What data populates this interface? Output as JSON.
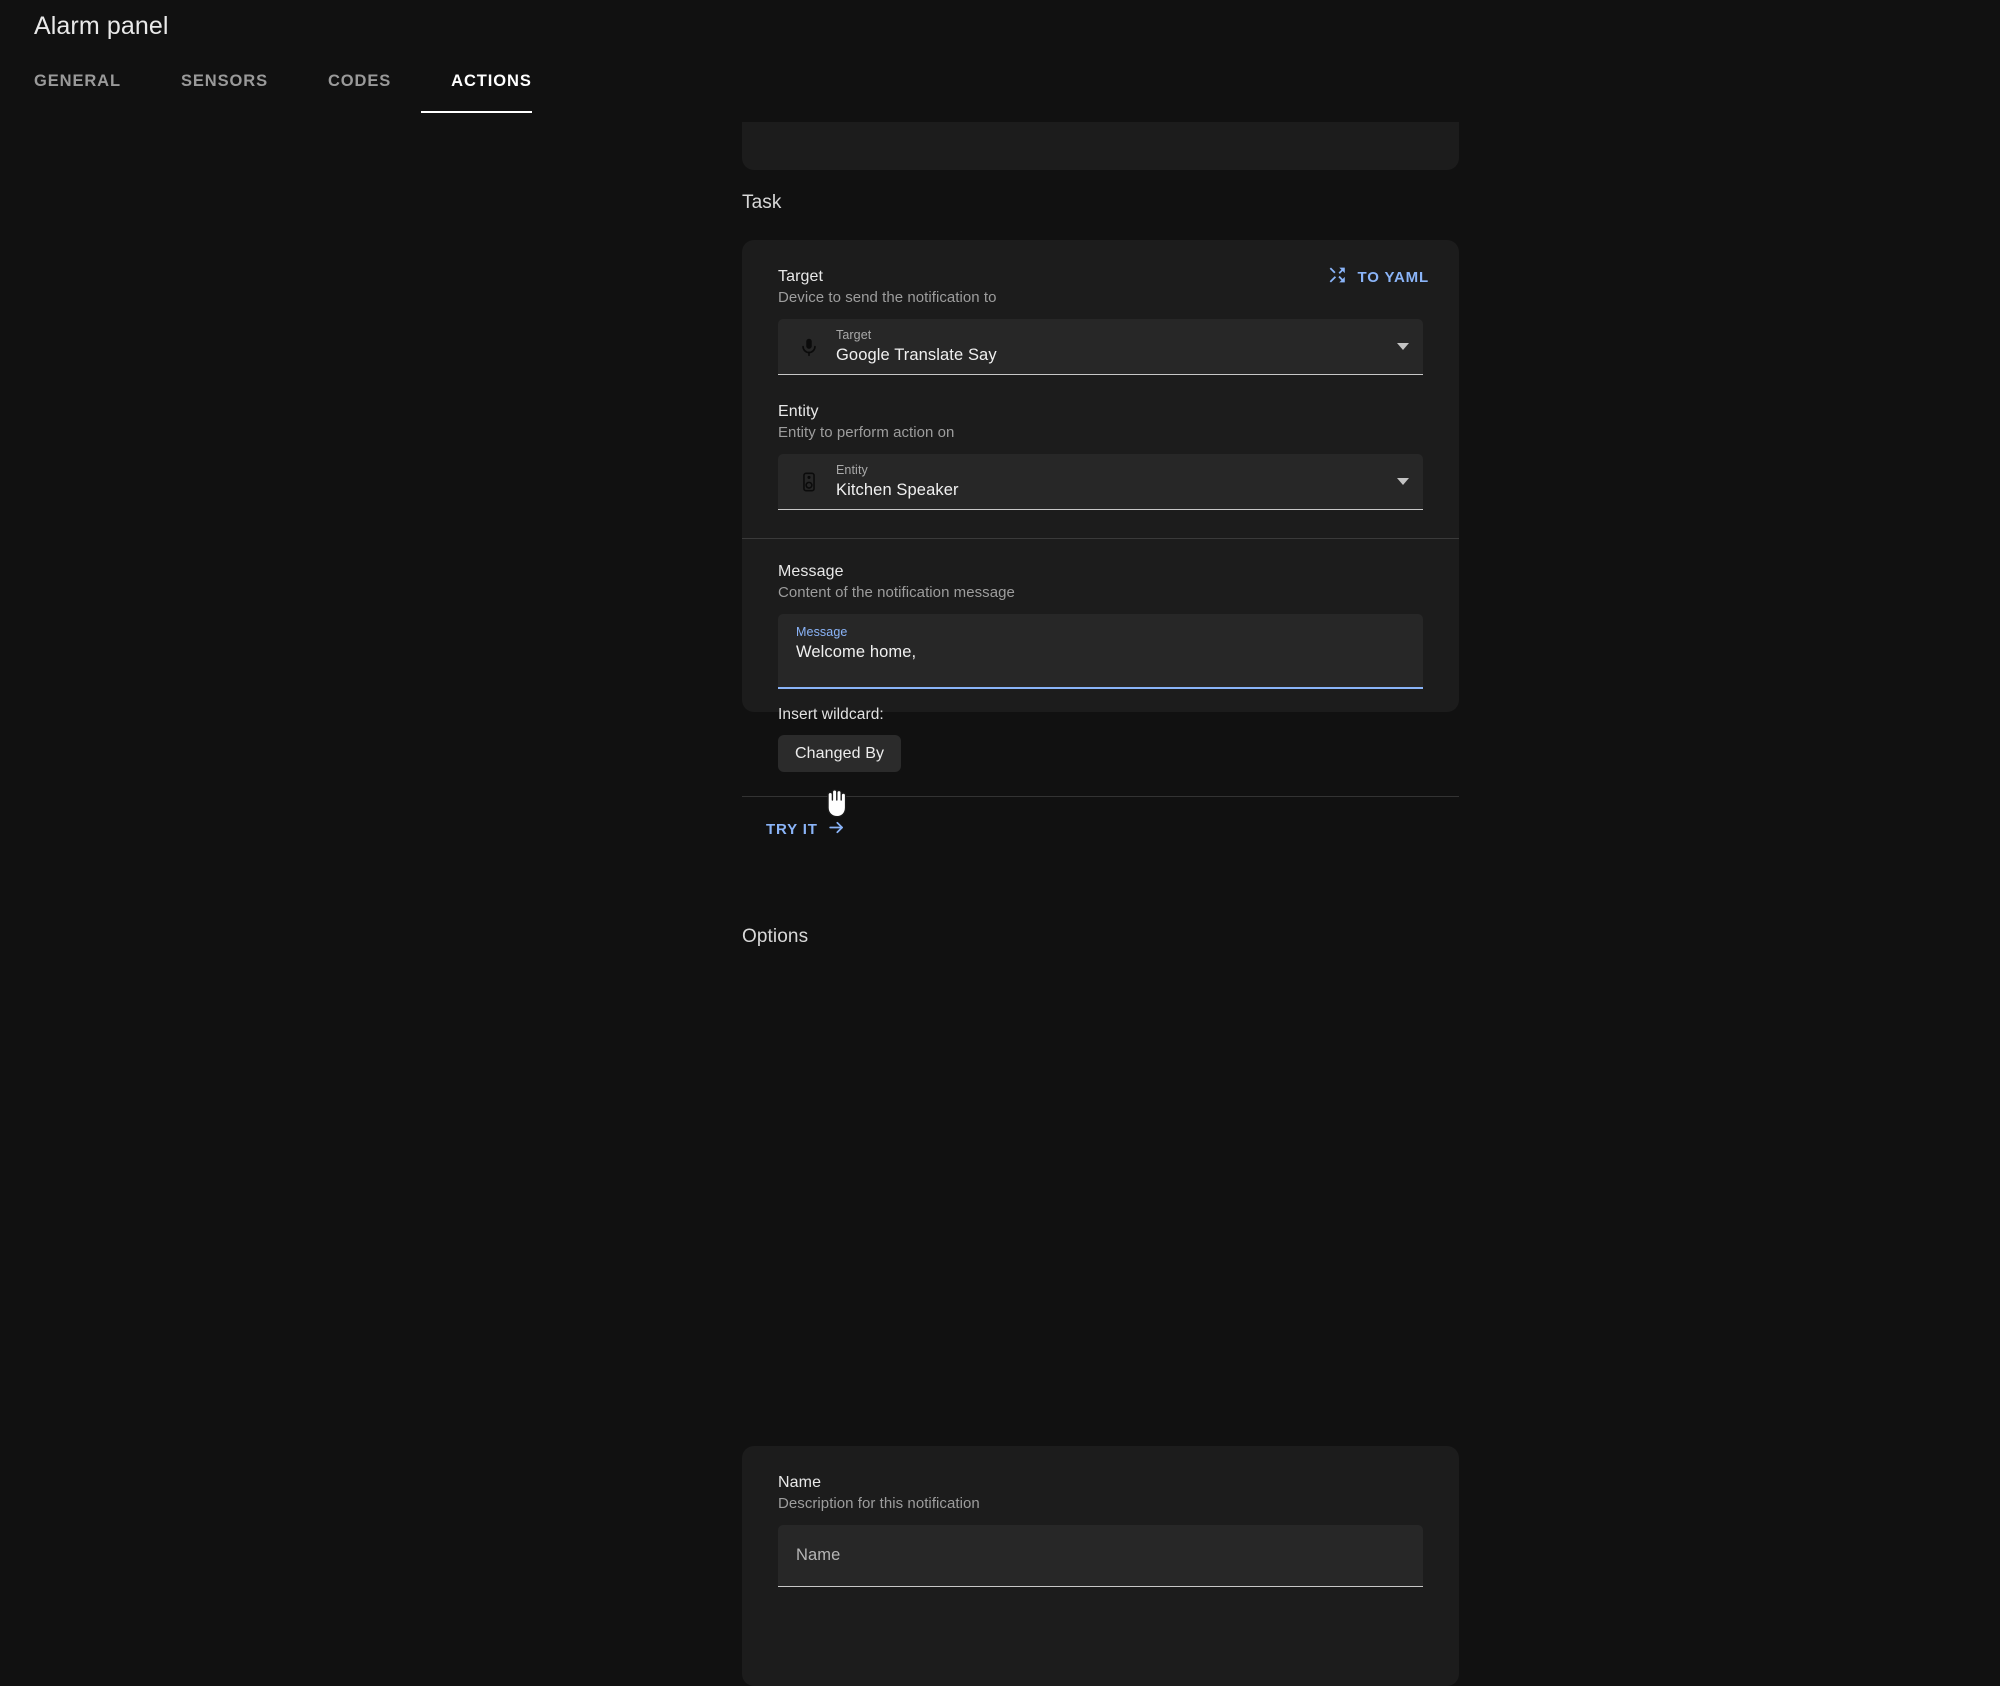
{
  "header": {
    "title": "Alarm panel",
    "tabs": [
      {
        "label": "GENERAL",
        "active": false
      },
      {
        "label": "SENSORS",
        "active": false
      },
      {
        "label": "CODES",
        "active": false
      },
      {
        "label": "ACTIONS",
        "active": true
      }
    ]
  },
  "sections": {
    "task": {
      "title": "Task",
      "to_yaml_label": "TO YAML",
      "to_yaml_icon": "shuffle-icon",
      "target": {
        "label": "Target",
        "description": "Device to send the notification to",
        "field_label": "Target",
        "value": "Google Translate Say",
        "icon": "microphone-icon"
      },
      "entity": {
        "label": "Entity",
        "description": "Entity to perform action on",
        "field_label": "Entity",
        "value": "Kitchen Speaker",
        "icon": "speaker-icon"
      },
      "message": {
        "label": "Message",
        "description": "Content of the notification message",
        "field_label": "Message",
        "value": "Welcome home,",
        "focused": true
      },
      "wildcard": {
        "label": "Insert wildcard:",
        "chips": [
          "Changed By"
        ]
      },
      "try_it_label": "TRY IT",
      "try_it_icon": "arrow-right-icon"
    },
    "options": {
      "title": "Options",
      "name": {
        "label": "Name",
        "description": "Description for this notification",
        "placeholder": "Name",
        "value": ""
      }
    }
  },
  "colors": {
    "page_bg": "#111111",
    "card_bg": "#1c1c1c",
    "input_bg": "#272727",
    "accent": "#8ab4f8",
    "text_primary": "#e8e8e8",
    "text_secondary": "#9d9d9d",
    "active_tab": "#ffffff"
  }
}
